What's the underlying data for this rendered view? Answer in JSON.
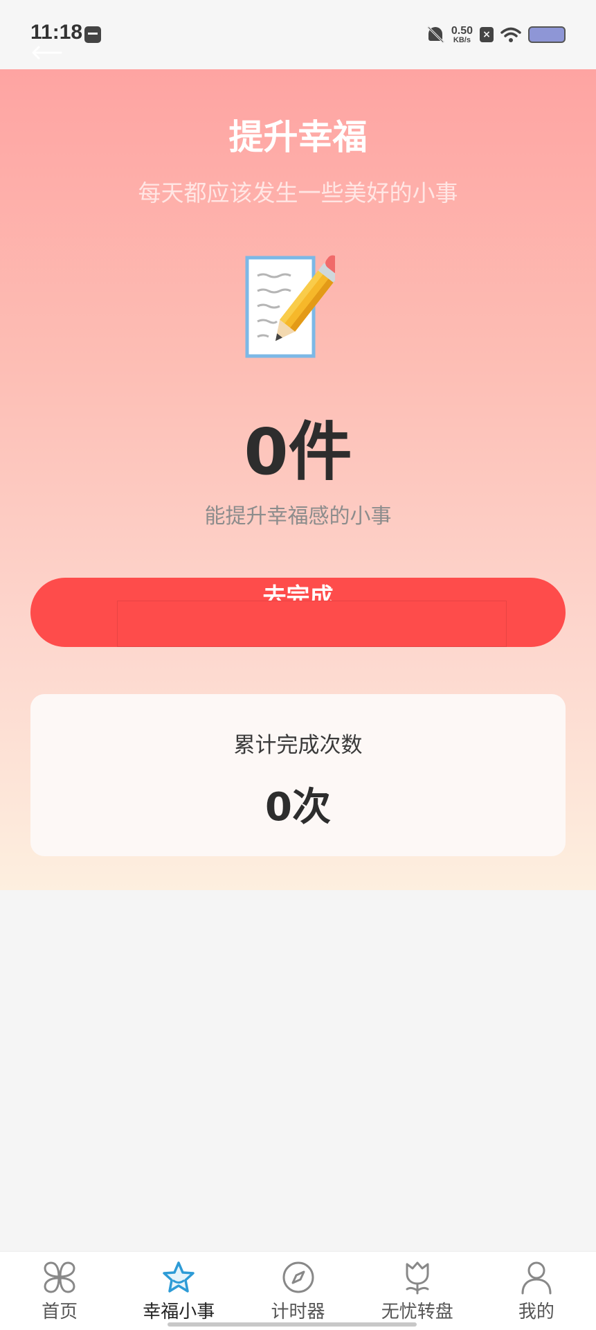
{
  "status_bar": {
    "time": "11:18",
    "net_speed_value": "0.50",
    "net_speed_unit": "KB/s",
    "x_badge": "×"
  },
  "hero": {
    "title": "提升幸福",
    "subtitle": "每天都应该发生一些美好的小事",
    "icon": "memo-pencil-icon",
    "count_value": "0件",
    "count_description": "能提升幸福感的小事",
    "button_label": "去完成"
  },
  "stats": {
    "label": "累计完成次数",
    "value": "0次"
  },
  "tab_bar": {
    "items": [
      {
        "label": "首页",
        "icon": "clover-icon",
        "active": false
      },
      {
        "label": "幸福小事",
        "icon": "star-icon",
        "active": true
      },
      {
        "label": "计时器",
        "icon": "compass-icon",
        "active": false
      },
      {
        "label": "无忧转盘",
        "icon": "tulip-icon",
        "active": false
      },
      {
        "label": "我的",
        "icon": "person-icon",
        "active": false
      }
    ]
  },
  "colors": {
    "accent_button": "#fe4c4b",
    "active_tab_icon": "#2d9bd6",
    "hero_top": "#fea4a2",
    "hero_bottom": "#fdefdf"
  }
}
